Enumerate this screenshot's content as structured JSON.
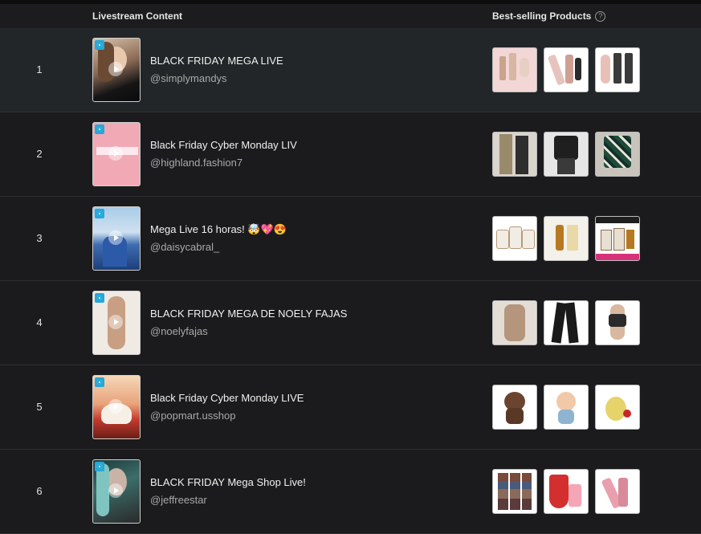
{
  "header": {
    "livestream_content": "Livestream Content",
    "best_selling_products": "Best-selling Products",
    "help_icon_glyph": "?"
  },
  "rows": [
    {
      "rank": "1",
      "title": "BLACK FRIDAY MEGA LIVE",
      "handle": "@simplymandys"
    },
    {
      "rank": "2",
      "title": "Black Friday Cyber Monday LIV",
      "handle": "@highland.fashion7"
    },
    {
      "rank": "3",
      "title": "Mega Live 16 horas! 🤯💖😍",
      "handle": "@daisycabral_"
    },
    {
      "rank": "4",
      "title": "BLACK FRIDAY MEGA DE NOELY FAJAS",
      "handle": "@noelyfajas"
    },
    {
      "rank": "5",
      "title": "Black Friday Cyber Monday LIVE",
      "handle": "@popmart.usshop"
    },
    {
      "rank": "6",
      "title": "BLACK FRIDAY Mega Shop Live!",
      "handle": "@jeffreestar"
    }
  ],
  "colors": {
    "background": "#1b1b1d",
    "active_row": "#222628",
    "live_badge": "#26a8d8"
  }
}
